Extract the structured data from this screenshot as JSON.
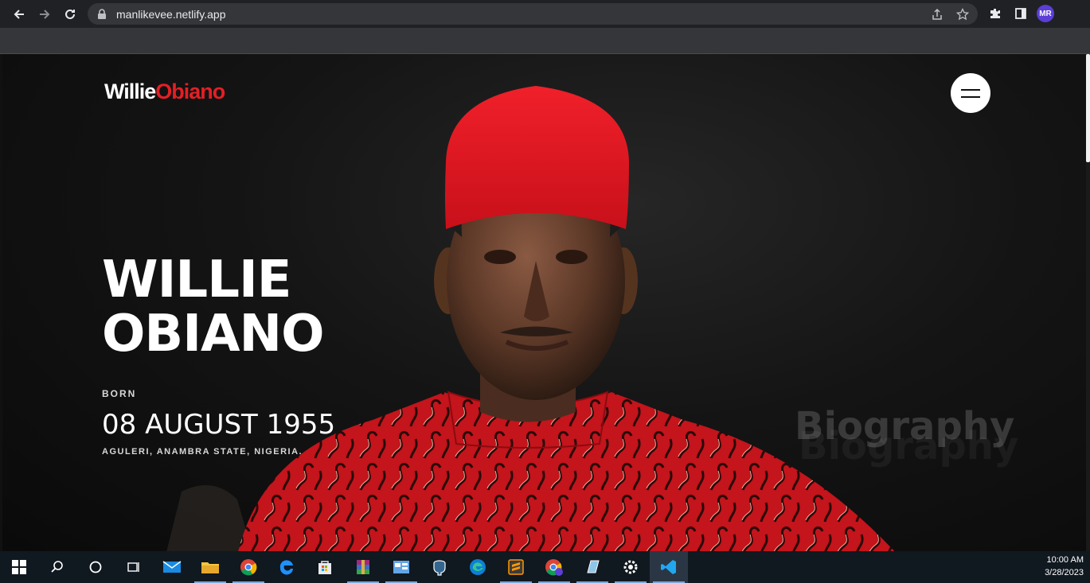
{
  "browser": {
    "url": "manlikevee.netlify.app",
    "profile_initials": "MR",
    "icons": [
      "back-icon",
      "forward-icon",
      "reload-icon",
      "lock-icon",
      "share-icon",
      "star-icon",
      "extensions-icon",
      "side-panel-icon"
    ]
  },
  "site": {
    "logo_first": "Willie",
    "logo_last": "Obiano",
    "hero_name_line1": "WILLIE",
    "hero_name_line2": "OBIANO",
    "born_label": "BORN",
    "born_date": "08 AUGUST 1955",
    "born_place": "AGULERI, ANAMBRA STATE, NIGERIA.",
    "section_watermark": "Biography",
    "colors": {
      "accent": "#e41f25",
      "background": "#111111",
      "text": "#ffffff"
    }
  },
  "taskbar": {
    "time": "10:00 AM",
    "date": "3/28/2023",
    "apps": [
      "windows-start-icon",
      "search-icon",
      "cortana-icon",
      "task-view-icon",
      "mail-icon",
      "file-explorer-icon",
      "chrome-icon",
      "edge-legacy-icon",
      "store-icon",
      "winrar-icon",
      "control-panel-icon",
      "postgres-icon",
      "edge-icon",
      "sublime-icon",
      "chrome-profile-icon",
      "notepad-icon",
      "settings-icon",
      "vscode-icon"
    ]
  }
}
